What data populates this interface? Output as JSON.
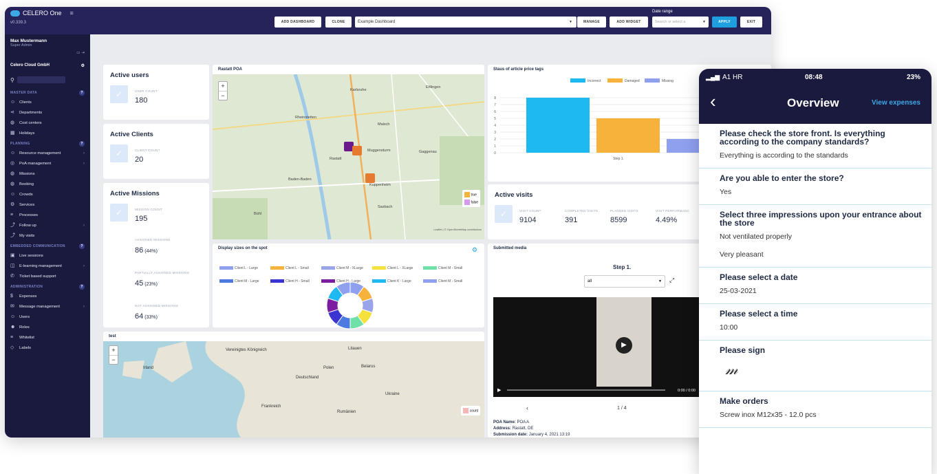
{
  "app": {
    "brand": "CELERO One",
    "version": "v0.339.3"
  },
  "user": {
    "name": "Max Mustermann",
    "role": "Super Admin"
  },
  "company": "Celero Cloud GmbH",
  "sidebar": {
    "sections": [
      {
        "title": "MASTER DATA",
        "items": [
          {
            "label": "Clients",
            "icon": "users-icon"
          },
          {
            "label": "Departments",
            "icon": "share-icon"
          },
          {
            "label": "Cost centers",
            "icon": "globe-icon"
          },
          {
            "label": "Holidays",
            "icon": "calendar-icon"
          }
        ]
      },
      {
        "title": "PLANNING",
        "items": [
          {
            "label": "Resource management",
            "icon": "users-icon",
            "arrow": true
          },
          {
            "label": "PoA management",
            "icon": "pin-icon",
            "arrow": true
          },
          {
            "label": "Missions",
            "icon": "globe-icon"
          },
          {
            "label": "Booking",
            "icon": "globe-icon"
          },
          {
            "label": "Crowds",
            "icon": "users-icon"
          },
          {
            "label": "Services",
            "icon": "gear-icon"
          },
          {
            "label": "Processes",
            "icon": "list-icon"
          },
          {
            "label": "Follow up",
            "icon": "route-icon",
            "arrow": true
          },
          {
            "label": "My visits",
            "icon": "route-icon"
          }
        ]
      },
      {
        "title": "EMBEDDED COMMUNICATION",
        "items": [
          {
            "label": "Live sessions",
            "icon": "video-icon"
          },
          {
            "label": "E-learning management",
            "icon": "book-icon",
            "arrow": true
          },
          {
            "label": "Ticket based support",
            "icon": "support-icon"
          }
        ]
      },
      {
        "title": "ADMINISTRATION",
        "items": [
          {
            "label": "Expenses",
            "icon": "dollar-icon"
          },
          {
            "label": "Message management",
            "icon": "mail-icon",
            "arrow": true
          },
          {
            "label": "Users",
            "icon": "users-icon"
          },
          {
            "label": "Roles",
            "icon": "roles-icon"
          },
          {
            "label": "Whitelist",
            "icon": "list-icon"
          },
          {
            "label": "Labels",
            "icon": "tag-icon"
          }
        ]
      }
    ]
  },
  "topbar": {
    "add_dashboard": "ADD DASHBOARD",
    "clone": "CLONE",
    "dashboard_select": "Example Dashboard",
    "manage": "MANAGE",
    "add_widget": "ADD WIDGET",
    "date_range_label": "Date range",
    "date_range_placeholder": "Search or select a",
    "apply": "APPLY",
    "exit": "EXIT"
  },
  "widgets": {
    "active_users": {
      "title": "Active users",
      "label": "USER COUNT",
      "value": "180"
    },
    "active_clients": {
      "title": "Active Clients",
      "label": "CLIENT COUNT",
      "value": "20"
    },
    "active_missions": {
      "title": "Active Missions",
      "label": "MISSION COUNT",
      "value": "195",
      "rows": [
        {
          "label": "ASSIGNED MISSIONS",
          "value": "86",
          "pct": "(44%)"
        },
        {
          "label": "PARTIALLY ASSIGNED MISSIONS",
          "value": "45",
          "pct": "(23%)"
        },
        {
          "label": "NOT ASSIGNED MISSIONS",
          "value": "64",
          "pct": "(33%)"
        }
      ]
    },
    "map_rastatt": {
      "title": "Rastatt POA",
      "legend": [
        "true",
        "false"
      ],
      "places": [
        "Karlsruhe",
        "Ettlingen",
        "Rheinstetten",
        "Malsch",
        "Rastatt",
        "Muggensturm",
        "Gaggenau",
        "Baden-Baden",
        "Bühl",
        "Kuppenheim",
        "Sasbach"
      ],
      "attribution": "Leaflet | © OpenStreetMap contributors"
    },
    "price_tags": {
      "title": "Staus of article price tags",
      "chart_data": {
        "type": "bar",
        "categories": [
          "Step 1."
        ],
        "series": [
          {
            "name": "Incorrect",
            "values": [
              8
            ],
            "color": "#1eb9f0"
          },
          {
            "name": "Damaged",
            "values": [
              5
            ],
            "color": "#f7b23b"
          },
          {
            "name": "Missing",
            "values": [
              2
            ],
            "color": "#8fa0ef"
          }
        ],
        "ylim": [
          0,
          8
        ],
        "yticks": [
          "0",
          "1",
          "2",
          "3",
          "4",
          "5",
          "6",
          "7",
          "8"
        ]
      }
    },
    "display_sizes": {
      "title": "Display sizes on the spot",
      "chart_data": {
        "type": "pie",
        "series": [
          {
            "name": "Client L - Large",
            "color": "#8fa0ef"
          },
          {
            "name": "Client L - Small",
            "color": "#f7b23b"
          },
          {
            "name": "Client M - XLarge",
            "color": "#9aa4e8"
          },
          {
            "name": "Client L - XLarge",
            "color": "#f5e13b"
          },
          {
            "name": "Client M - Small",
            "color": "#6fe0a8"
          },
          {
            "name": "Client M - Large",
            "color": "#4b7be0"
          },
          {
            "name": "Client H - Small",
            "color": "#3a34d0"
          },
          {
            "name": "Client H - Large",
            "color": "#7b1fa0"
          },
          {
            "name": "Client K - Large",
            "color": "#1eb9f0"
          },
          {
            "name": "Client M - Small",
            "color": "#8fa0ef"
          }
        ]
      }
    },
    "active_visits": {
      "title": "Active visits",
      "cols": [
        {
          "label": "VISIT COUNT",
          "value": "9104"
        },
        {
          "label": "COMPLETED VISITS",
          "value": "391"
        },
        {
          "label": "PLANNED VISITS",
          "value": "8599"
        },
        {
          "label": "VISIT PERFORMANC",
          "value": "4.49%"
        }
      ]
    },
    "submitted_media": {
      "title": "Submitted media",
      "step": "Step 1.",
      "filter": "all",
      "time": "0:00 / 0:00",
      "pager": "1 / 4",
      "poa_label": "POA Name:",
      "poa_value": "POA A",
      "addr_label": "Address:",
      "addr_value": "Rastatt, DE",
      "date_label": "Submission date:",
      "date_value": "January 4, 2021 13:19"
    },
    "test_map": {
      "title": "test",
      "places": [
        "Vereinigtes Königreich",
        "Litauen",
        "Polen",
        "Belarus",
        "Deutschland",
        "Ukraine",
        "Frankreich",
        "Rumänien",
        "Irland"
      ],
      "legend": "count"
    }
  },
  "phone": {
    "carrier": "A1 HR",
    "time": "08:48",
    "battery": "23%",
    "title": "Overview",
    "action": "View expenses",
    "items": [
      {
        "q": "Please check the store front. Is everything according to the company standards?",
        "a": [
          "Everything is according to the standards"
        ]
      },
      {
        "q": "Are you able to enter the store?",
        "a": [
          "Yes"
        ]
      },
      {
        "q": "Select three impressions upon your entrance about the store",
        "a": [
          "Not ventilated properly",
          "Very pleasant"
        ]
      },
      {
        "q": "Please select a date",
        "a": [
          "25-03-2021"
        ]
      },
      {
        "q": "Please select a time",
        "a": [
          "10:00"
        ]
      },
      {
        "q": "Please sign",
        "a": []
      },
      {
        "q": "Make orders",
        "a": [
          "Screw inox M12x35 - 12.0 pcs"
        ]
      }
    ]
  }
}
